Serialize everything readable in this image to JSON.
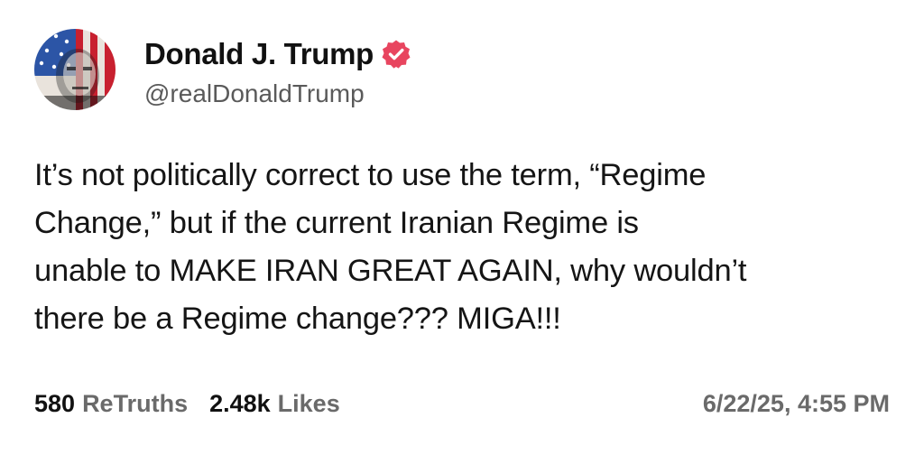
{
  "author": {
    "display_name": "Donald J. Trump",
    "handle": "@realDonaldTrump",
    "avatar_icon": "flag-face-avatar",
    "verified_icon": "verified-badge-icon",
    "verified_color": "#e8455f"
  },
  "post": {
    "lines": [
      "It’s not politically correct to use the term, “Regime",
      "Change,” but if the current Iranian Regime is",
      "unable to MAKE IRAN GREAT AGAIN, why wouldn’t",
      "there be a Regime change??? MIGA!!!"
    ]
  },
  "stats": {
    "retruths_count": "580",
    "retruths_label": "ReTruths",
    "likes_count": "2.48k",
    "likes_label": "Likes"
  },
  "timestamp": "6/22/25, 4:55 PM"
}
